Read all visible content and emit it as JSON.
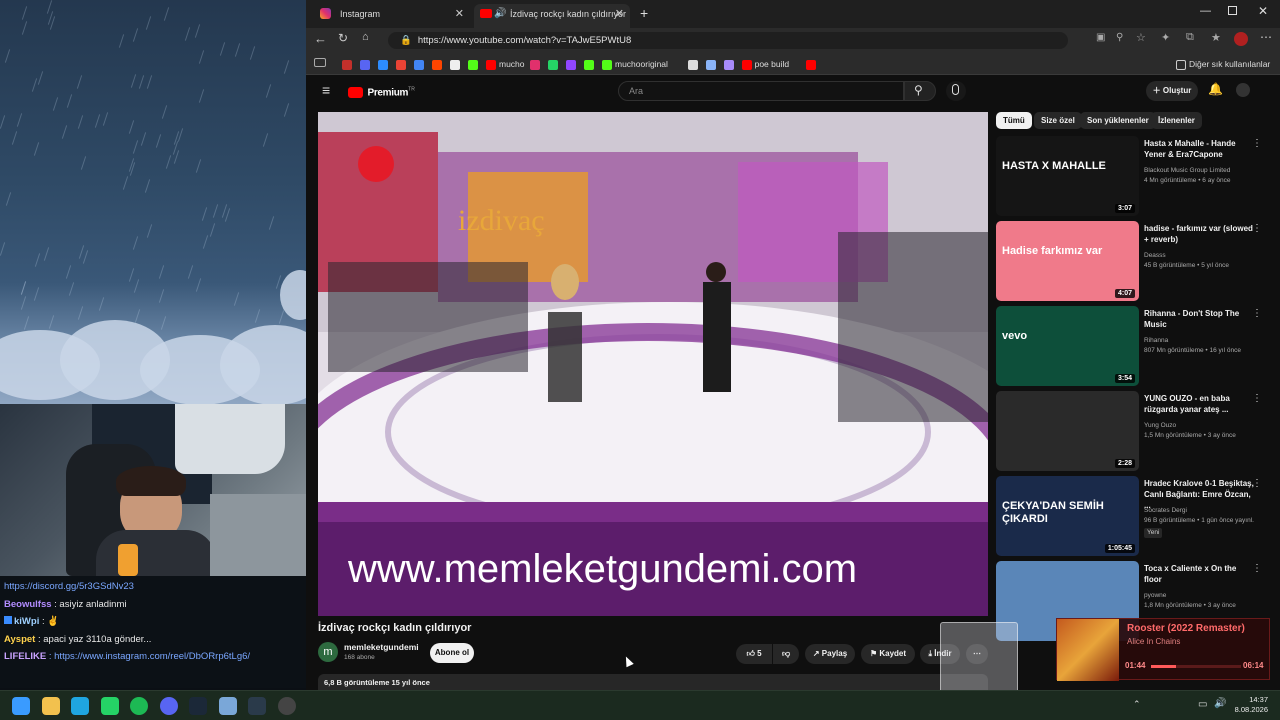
{
  "chat": {
    "lines": [
      {
        "user": "https://discord.gg/5r3GSdNv23",
        "msg": "",
        "user_color": "#7aa7ff"
      },
      {
        "user": "Beowulfss",
        "msg": ": asiyiz anladinmi",
        "user_color": "#b28cff"
      },
      {
        "user": "kiWpi",
        "msg": ": ✌",
        "user_color": "#9fd1ff"
      },
      {
        "user": "Ayspet",
        "msg": ": apaci yaz 3110a gönder...",
        "user_color": "#ffd24d"
      },
      {
        "user": "LIFELIKE",
        "msg": ": https://www.instagram.com/reel/DbORrp6tLg6/",
        "user_color": "#c9a3ff"
      }
    ]
  },
  "browser": {
    "tabs": [
      {
        "label": "Instagram",
        "icon": "instagram-icon"
      },
      {
        "label": "İzdivaç rockçı kadın çıldırıyor",
        "icon": "youtube-icon"
      }
    ],
    "url": "https://www.youtube.com/watch?v=TAJwE5PWtU8",
    "bookmarks": [
      {
        "label": "",
        "color": "#c4302b"
      },
      {
        "label": "",
        "color": "#5865f2"
      },
      {
        "label": "",
        "color": "#2d8cff"
      },
      {
        "label": "",
        "color": "#ea4335"
      },
      {
        "label": "",
        "color": "#4285f4"
      },
      {
        "label": "",
        "color": "#ff4500"
      },
      {
        "label": "",
        "color": "#eeeeee"
      },
      {
        "label": "",
        "color": "#53fc18"
      },
      {
        "label": "mucho",
        "color": "#ff0000"
      },
      {
        "label": "",
        "color": "#e1306c"
      },
      {
        "label": "",
        "color": "#25d366"
      },
      {
        "label": "",
        "color": "#9146ff"
      },
      {
        "label": "",
        "color": "#53fc18"
      },
      {
        "label": "muchooriginal",
        "color": "#53fc18"
      },
      {
        "label": "",
        "color": "#dddddd"
      },
      {
        "label": "",
        "color": "#8ab4f8"
      },
      {
        "label": "",
        "color": "#a78bfa"
      },
      {
        "label": "poe build",
        "color": "#ff0000"
      },
      {
        "label": "",
        "color": "#ff0000"
      }
    ],
    "other_bookmarks": "Diğer sık kullanılanlar"
  },
  "youtube": {
    "logo": "Premium",
    "logo_sup": "TR",
    "search_placeholder": "Ara",
    "create_label": "Oluştur",
    "video": {
      "title": "İzdivaç rockçı kadın çıldırıyor",
      "watermark": "www.memleketgundemi.com",
      "set_text": "izdivaç",
      "channel": "memleketgundemi",
      "avatar_letter": "m",
      "subscribers": "168 abone",
      "subscribe_label": "Abone ol",
      "likes": "5",
      "share_label": "Paylaş",
      "save_label": "Kaydet",
      "download_label": "İndir",
      "views_line": "6,8 B görüntüleme  15 yıl önce"
    },
    "chips": [
      "Tümü",
      "Size özel",
      "Son yüklenenler",
      "İzlenenler"
    ],
    "recommendations": [
      {
        "title": "Hasta x Mahalle - Hande Yener & Era7Capone",
        "channel": "Blackout Music Group Limited",
        "meta": "4 Mn görüntüleme • 6 ay önce",
        "duration": "3:07",
        "thumb_text": "HASTA X MAHALLE",
        "bg": "#151515"
      },
      {
        "title": "hadise - farkımız var (slowed + reverb)",
        "channel": "Deasss",
        "meta": "45 B görüntüleme • 5 yıl önce",
        "duration": "4:07",
        "thumb_text": "Hadise farkımız var",
        "bg": "#f07a8a"
      },
      {
        "title": "Rihanna - Don't Stop The Music",
        "channel": "Rihanna",
        "meta": "807 Mn görüntüleme • 16 yıl önce",
        "duration": "3:54",
        "thumb_text": "vevo",
        "bg": "#0d4f3a"
      },
      {
        "title": "YUNG OUZO - en baba rüzgarda yanar ateş ...",
        "channel": "Yung Ouzo",
        "meta": "1,5 Mn görüntüleme • 3 ay önce",
        "duration": "2:28",
        "thumb_text": "",
        "bg": "#2a2a2a"
      },
      {
        "title": "Hradec Kralove 0-1 Beşiktaş, Canlı Bağlantı: Emre Özcan, ...",
        "channel": "Socrates Dergi",
        "meta": "96 B görüntüleme • 1 gün önce yayınl...",
        "duration": "1:05:45",
        "thumb_text": "ÇEKYA'DAN SEMİH ÇIKARDI",
        "bg": "#1a2a4a",
        "badge": "Yeni"
      },
      {
        "title": "Toca x Caliente x On the floor",
        "channel": "pyowne",
        "meta": "1,8 Mn görüntüleme • 3 ay önce",
        "duration": "",
        "thumb_text": "",
        "bg": "#5a86b8"
      }
    ]
  },
  "now_playing": {
    "title": "Rooster (2022 Remaster)",
    "artist": "Alice In Chains",
    "current": "01:44",
    "total": "06:14",
    "progress": 0.28
  },
  "taskbar": {
    "time": "14:37",
    "date": "8.08.2026"
  }
}
